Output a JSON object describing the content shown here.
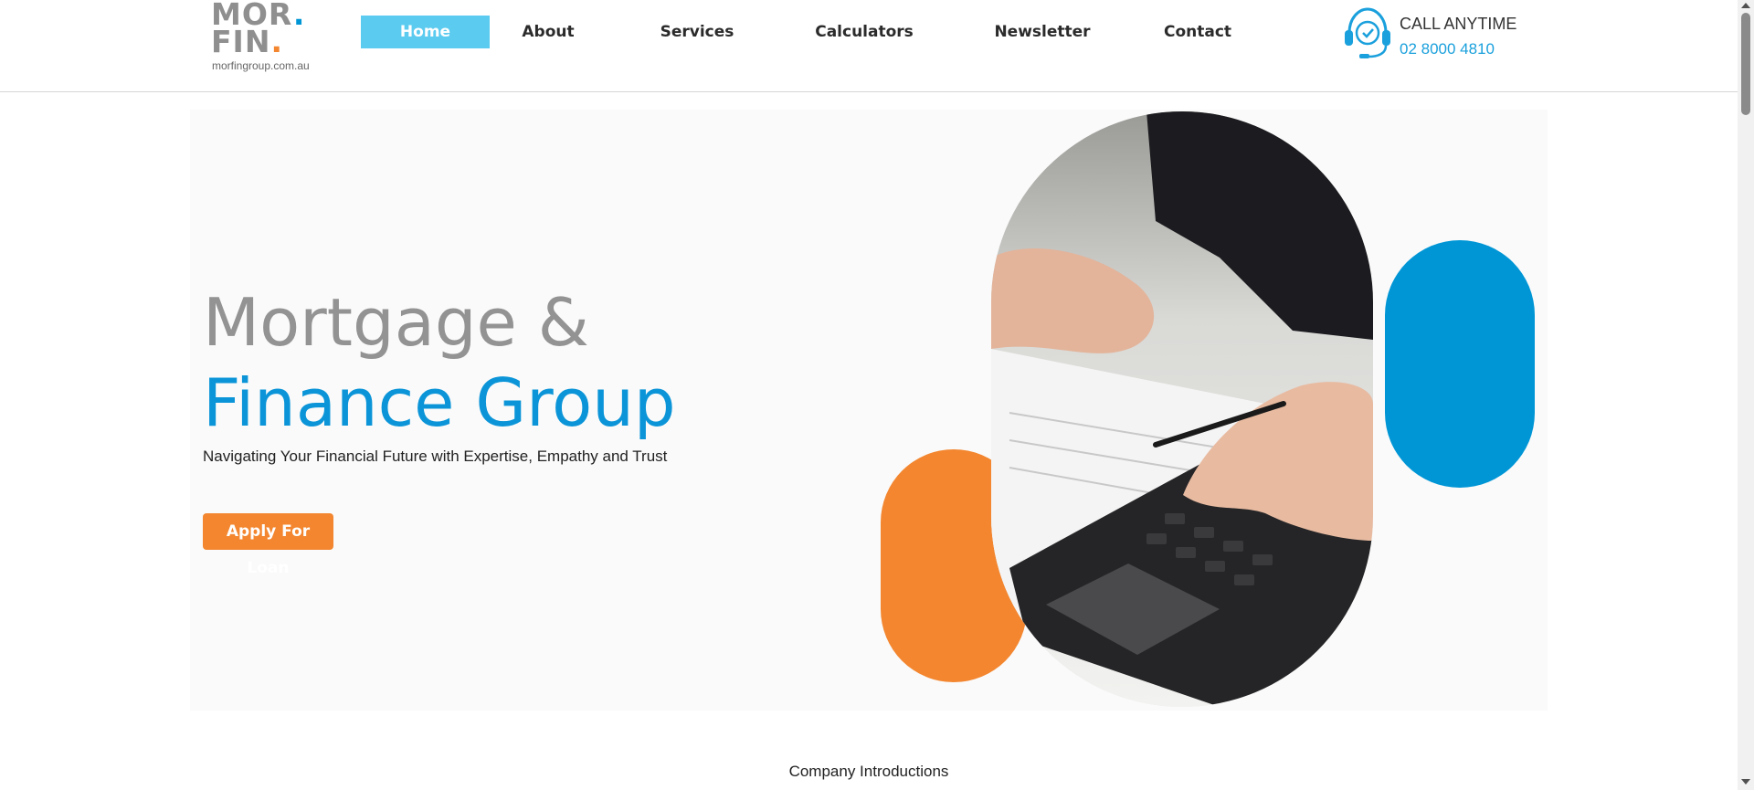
{
  "logo": {
    "line1": "MOR",
    "line2": "FIN",
    "dot": ".",
    "url": "morfingroup.com.au"
  },
  "nav": {
    "items": [
      {
        "label": "Home",
        "active": true
      },
      {
        "label": "About"
      },
      {
        "label": "Services"
      },
      {
        "label": "Calculators"
      },
      {
        "label": "Newsletter"
      },
      {
        "label": "Contact"
      }
    ]
  },
  "contact": {
    "title": "CALL ANYTIME",
    "phone": "02 8000 4810",
    "icon": "headset-clock-icon"
  },
  "hero": {
    "title_line1": "Mortgage &",
    "title_line2": "Finance Group",
    "subtitle": "Navigating Your Financial Future with Expertise, Empathy and Trust",
    "cta": "Apply For Loan",
    "image": "calculator-hands-photo"
  },
  "section": {
    "intro_label": "Company Introductions"
  },
  "colors": {
    "brand_blue": "#0096d6",
    "brand_orange": "#f3862f",
    "nav_active": "#5ccbf0",
    "grey_title": "#939393"
  }
}
